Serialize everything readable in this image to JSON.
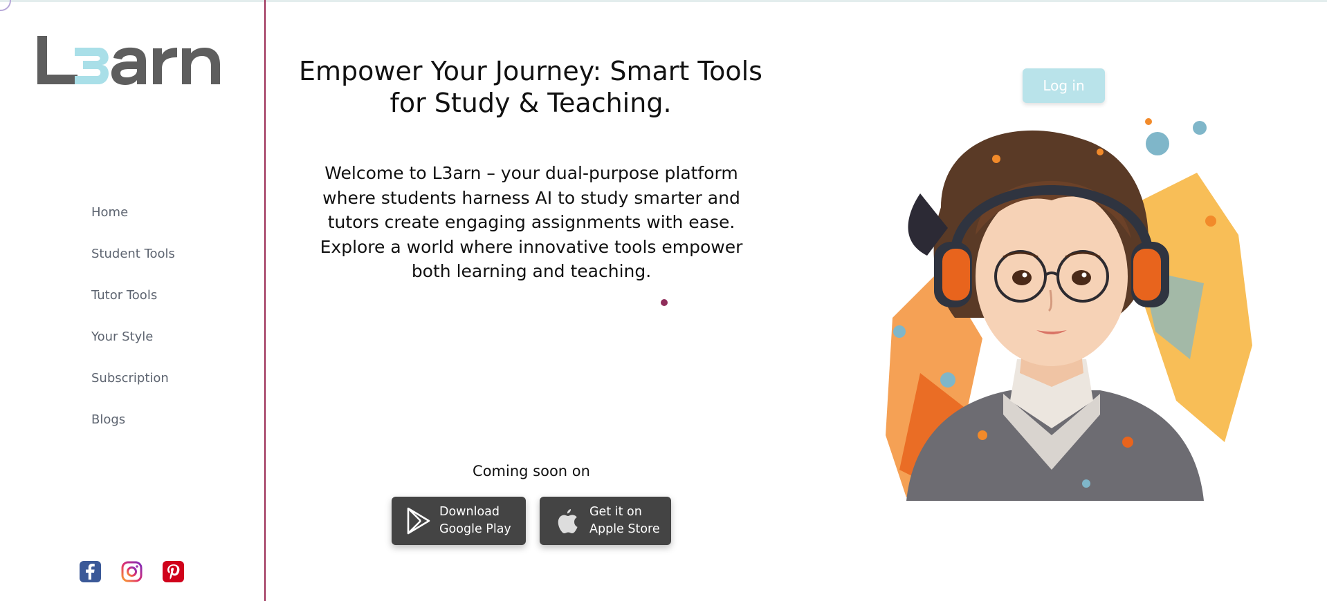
{
  "brand": {
    "logo_text": "L3arn",
    "logo_color": "#5e5e5e",
    "logo_accent": "#a9dfe8"
  },
  "nav": {
    "items": [
      {
        "label": "Home"
      },
      {
        "label": "Student Tools"
      },
      {
        "label": "Tutor Tools"
      },
      {
        "label": "Your Style"
      },
      {
        "label": "Subscription"
      },
      {
        "label": "Blogs"
      }
    ]
  },
  "social": {
    "icons": [
      "facebook-icon",
      "instagram-icon",
      "pinterest-icon"
    ]
  },
  "hero": {
    "title": "Empower Your Journey: Smart Tools for Study & Teaching.",
    "description": "Welcome to L3arn – your dual-purpose platform where students harness AI to study smarter and tutors create engaging assignments with ease. Explore a world where innovative tools empower both learning and teaching."
  },
  "apps": {
    "coming_soon": "Coming soon on",
    "google_play": {
      "line1": "Download",
      "line2": "Google Play"
    },
    "apple_store": {
      "line1": "Get it on",
      "line2": "Apple Store"
    }
  },
  "header": {
    "login_label": "Log in"
  },
  "colors": {
    "sidebar_divider": "#9b2d55",
    "login_bg": "#b9e3ea",
    "store_btn_bg": "#444444",
    "dot": "#8f2d5a"
  }
}
